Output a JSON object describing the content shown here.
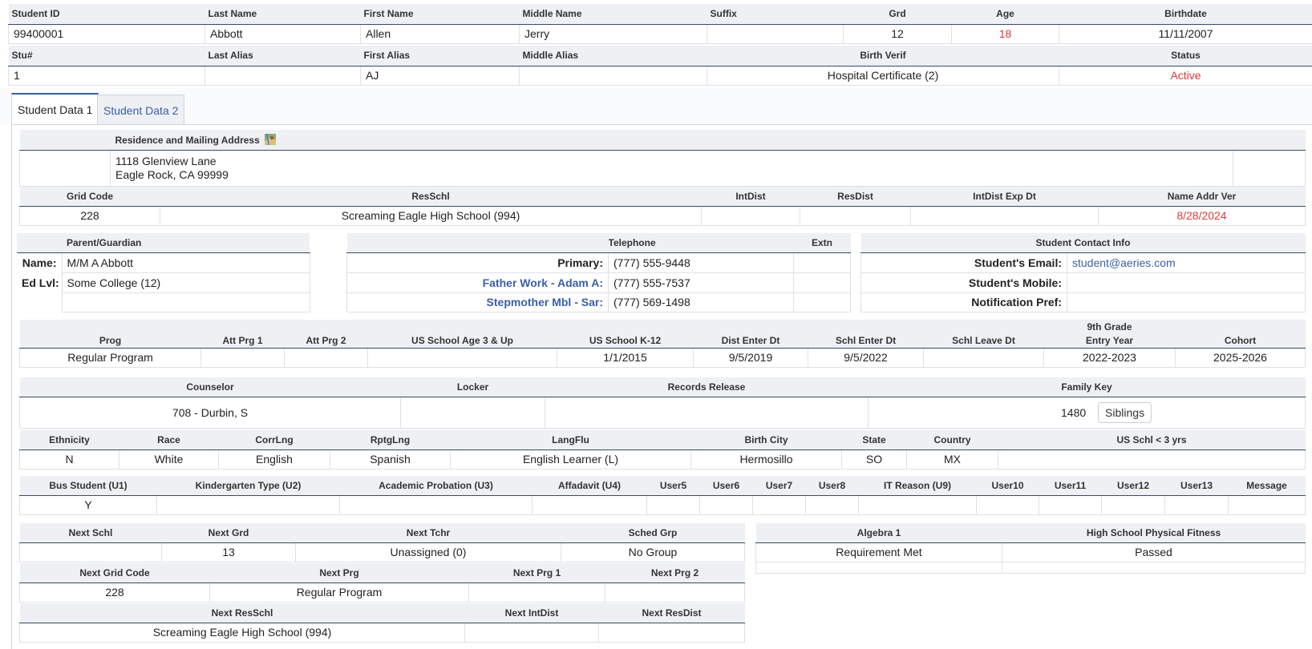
{
  "header": {
    "row1_labels": [
      "Student ID",
      "Last Name",
      "First Name",
      "Middle Name",
      "Suffix",
      "Grd",
      "Age",
      "Birthdate"
    ],
    "row1_values": [
      "99400001",
      "Abbott",
      "Allen",
      "Jerry",
      "",
      "12",
      "18",
      "11/11/2007"
    ],
    "row2_labels": [
      "Stu#",
      "Last Alias",
      "First Alias",
      "Middle Alias",
      "Birth Verif",
      "Status"
    ],
    "row2_values": [
      "1",
      "",
      "AJ",
      "",
      "Hospital Certificate (2)",
      "Active"
    ]
  },
  "tabs": [
    {
      "label": "Student Data 1"
    },
    {
      "label": "Student Data 2"
    }
  ],
  "address": {
    "title": "Residence and Mailing Address",
    "line1": "1118 Glenview Lane",
    "line2": "Eagle Rock, CA 99999"
  },
  "grid": {
    "labels": [
      "Grid Code",
      "ResSchl",
      "IntDist",
      "ResDist",
      "IntDist Exp Dt",
      "Name Addr Ver"
    ],
    "values": [
      "228",
      "Screaming Eagle High School (994)",
      "",
      "",
      "",
      "8/28/2024"
    ]
  },
  "parent": {
    "title": "Parent/Guardian",
    "name_label": "Name:",
    "name_value": "M/M A Abbott",
    "edlvl_label": "Ed Lvl:",
    "edlvl_value": "Some College (12)"
  },
  "telephone": {
    "title": "Telephone",
    "extn": "Extn",
    "rows": [
      {
        "label": "Primary:",
        "number": "(777) 555-9448"
      },
      {
        "label": "Father Work - Adam A:",
        "number": "(777) 555-7537"
      },
      {
        "label": "Stepmother Mbl - Sar:",
        "number": "(777) 569-1498"
      }
    ]
  },
  "contact": {
    "title": "Student Contact Info",
    "email_label": "Student's Email:",
    "email_value": "student@aeries.com",
    "mobile_label": "Student's Mobile:",
    "notif_label": "Notification Pref:"
  },
  "program": {
    "labels": [
      "Prog",
      "Att Prg 1",
      "Att Prg 2",
      "US School Age 3 & Up",
      "US School K-12",
      "Dist Enter Dt",
      "Schl Enter Dt",
      "Schl Leave Dt",
      "9th Grade",
      "Entry Year",
      "Cohort"
    ],
    "values": [
      "Regular Program",
      "",
      "",
      "",
      "1/1/2015",
      "9/5/2019",
      "9/5/2022",
      "",
      "2022-2023",
      "2025-2026"
    ]
  },
  "counselor": {
    "labels": [
      "Counselor",
      "Locker",
      "Records Release",
      "Family Key"
    ],
    "values": [
      "708 - Durbin, S",
      "",
      "",
      "1480"
    ],
    "siblings_button": "Siblings"
  },
  "ethnicity": {
    "labels": [
      "Ethnicity",
      "Race",
      "CorrLng",
      "RptgLng",
      "LangFlu",
      "Birth City",
      "State",
      "Country",
      "US Schl < 3 yrs"
    ],
    "values": [
      "N",
      "White",
      "English",
      "Spanish",
      "English Learner (L)",
      "Hermosillo",
      "SO",
      "MX",
      ""
    ]
  },
  "user": {
    "labels": [
      "Bus Student (U1)",
      "Kindergarten Type (U2)",
      "Academic Probation (U3)",
      "Affadavit (U4)",
      "User5",
      "User6",
      "User7",
      "User8",
      "IT Reason (U9)",
      "User10",
      "User11",
      "User12",
      "User13",
      "Message"
    ],
    "values": [
      "Y",
      "",
      "",
      "",
      "",
      "",
      "",
      "",
      "",
      "",
      "",
      "",
      "",
      ""
    ]
  },
  "next": {
    "labels1": [
      "Next Schl",
      "Next Grd",
      "Next Tchr",
      "Sched Grp"
    ],
    "values1": [
      "",
      "13",
      "Unassigned (0)",
      "No Group"
    ],
    "labels2": [
      "Next Grid Code",
      "Next Prg",
      "Next Prg 1",
      "Next Prg 2"
    ],
    "values2": [
      "228",
      "Regular Program",
      "",
      ""
    ],
    "labels3": [
      "Next ResSchl",
      "Next IntDist",
      "Next ResDist"
    ],
    "values3": [
      "Screaming Eagle High School (994)",
      "",
      ""
    ]
  },
  "requirements": {
    "labels": [
      "Algebra 1",
      "High School Physical Fitness"
    ],
    "values": [
      "Requirement Met",
      "Passed"
    ]
  },
  "colors": {
    "accent": "#3a5fa8",
    "alert": "#e03a3a",
    "header_bg": "#eef0f4",
    "rule": "#3a4a66"
  },
  "icons": {
    "map": "map-icon"
  }
}
